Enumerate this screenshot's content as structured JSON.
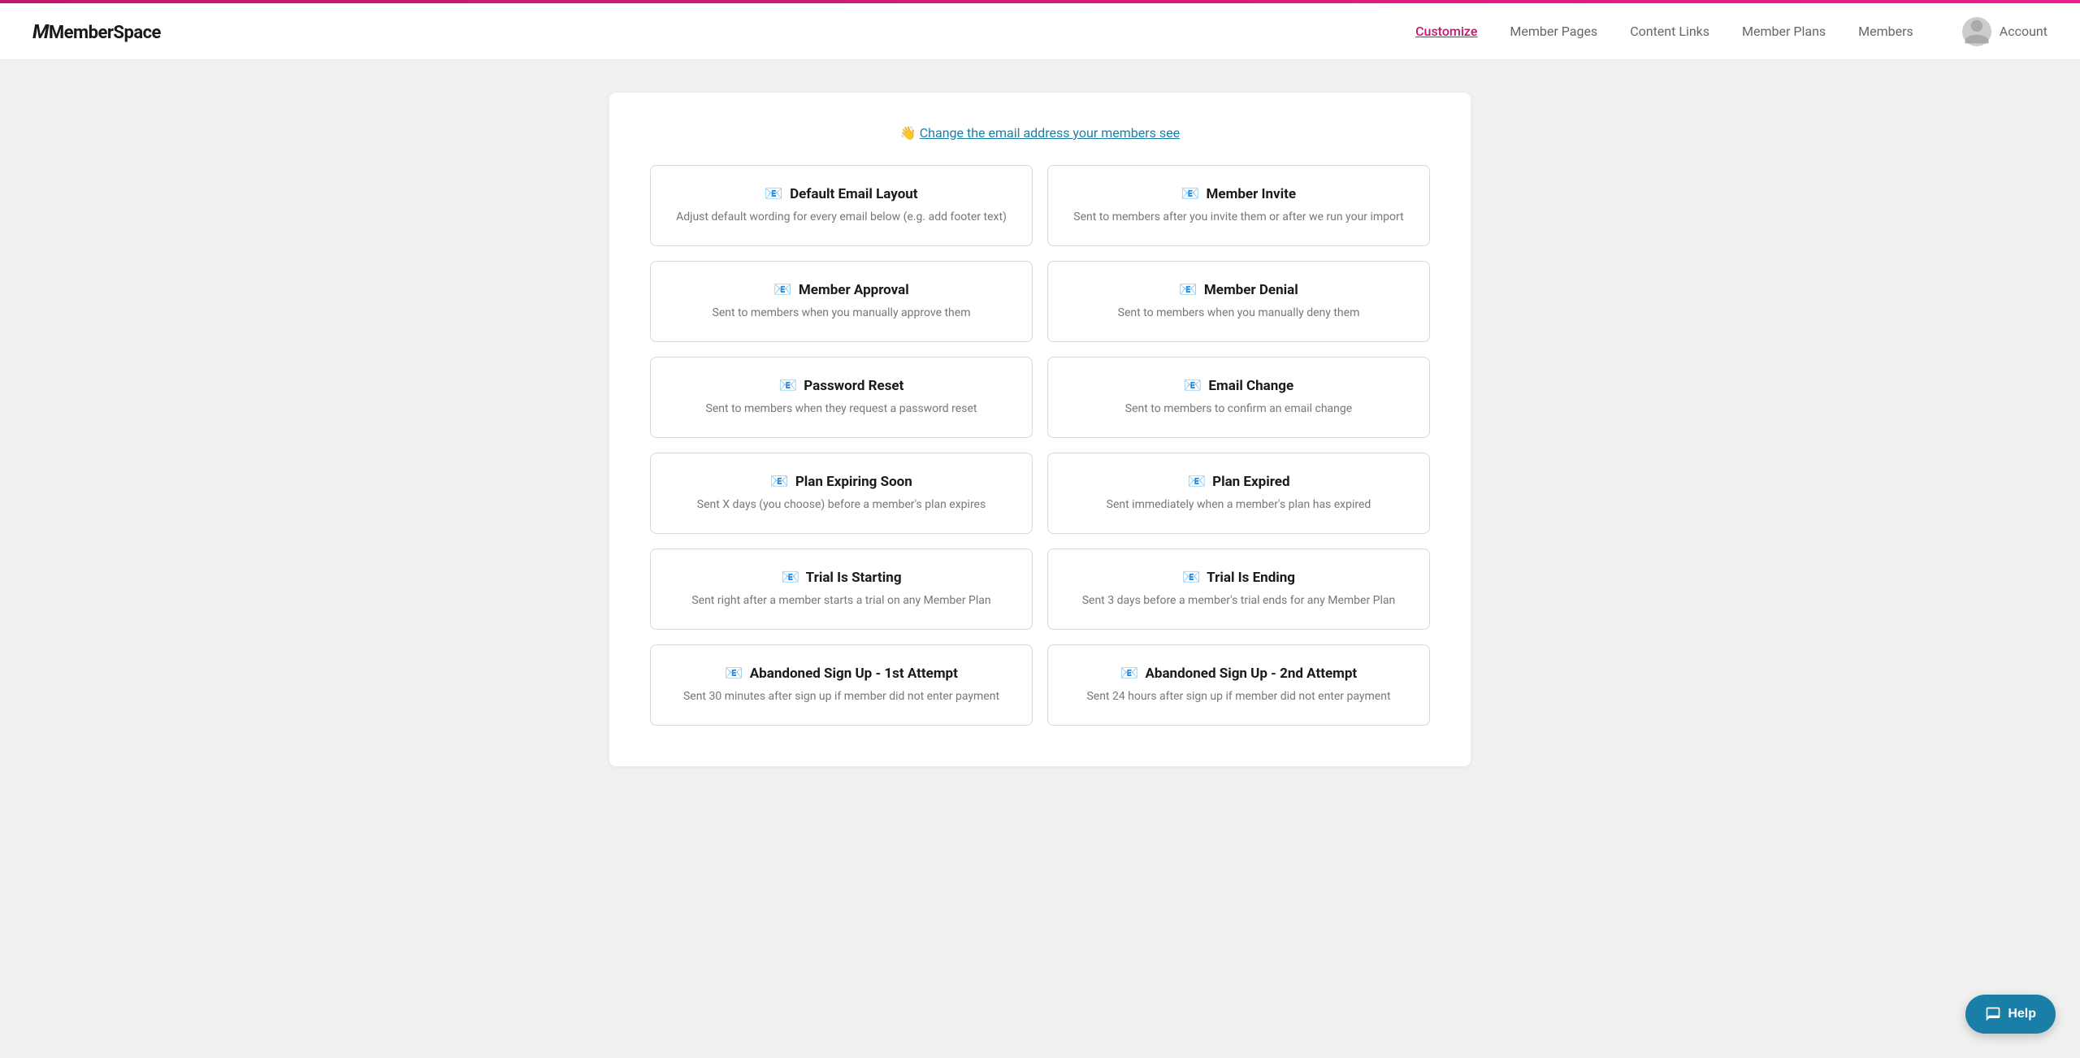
{
  "topbar": {
    "color": "#c0186c"
  },
  "navbar": {
    "logo": "MemberSpace",
    "links": [
      {
        "label": "Customize",
        "active": true
      },
      {
        "label": "Member Pages",
        "active": false
      },
      {
        "label": "Content Links",
        "active": false
      },
      {
        "label": "Member Plans",
        "active": false
      },
      {
        "label": "Members",
        "active": false
      }
    ],
    "account_label": "Account"
  },
  "page": {
    "email_link_emoji": "👋",
    "email_link_text": "Change the email address your members see",
    "cards": [
      {
        "icon": "📧",
        "title": "Default Email Layout",
        "desc": "Adjust default wording for every email below (e.g. add footer text)"
      },
      {
        "icon": "📧",
        "title": "Member Invite",
        "desc": "Sent to members after you invite them or after we run your import"
      },
      {
        "icon": "📧",
        "title": "Member Approval",
        "desc": "Sent to members when you manually approve them"
      },
      {
        "icon": "📧",
        "title": "Member Denial",
        "desc": "Sent to members when you manually deny them"
      },
      {
        "icon": "📧",
        "title": "Password Reset",
        "desc": "Sent to members when they request a password reset"
      },
      {
        "icon": "📧",
        "title": "Email Change",
        "desc": "Sent to members to confirm an email change"
      },
      {
        "icon": "📧",
        "title": "Plan Expiring Soon",
        "desc": "Sent X days (you choose) before a member's plan expires"
      },
      {
        "icon": "📧",
        "title": "Plan Expired",
        "desc": "Sent immediately when a member's plan has expired"
      },
      {
        "icon": "📧",
        "title": "Trial Is Starting",
        "desc": "Sent right after a member starts a trial on any Member Plan"
      },
      {
        "icon": "📧",
        "title": "Trial Is Ending",
        "desc": "Sent 3 days before a member's trial ends for any Member Plan"
      },
      {
        "icon": "📧",
        "title": "Abandoned Sign Up - 1st Attempt",
        "desc": "Sent 30 minutes after sign up if member did not enter payment"
      },
      {
        "icon": "📧",
        "title": "Abandoned Sign Up - 2nd Attempt",
        "desc": "Sent 24 hours after sign up if member did not enter payment"
      }
    ]
  },
  "help_button": {
    "label": "Help"
  }
}
